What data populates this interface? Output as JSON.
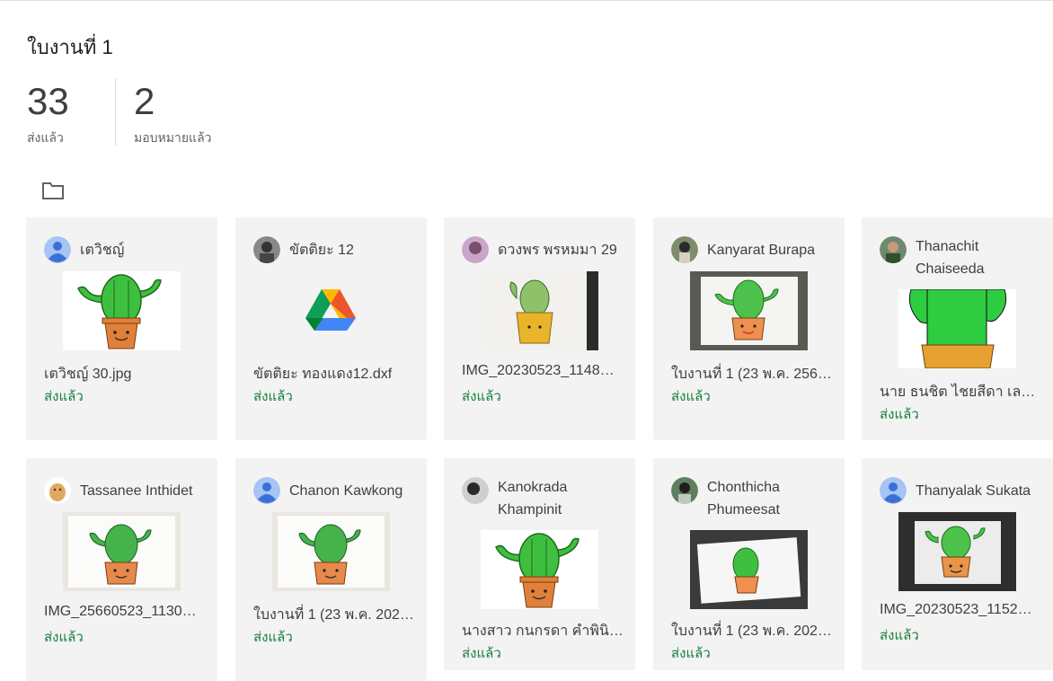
{
  "header": {
    "title": "ใบงานที่ 1",
    "submitted_count": "33",
    "submitted_label": "ส่งแล้ว",
    "assigned_count": "2",
    "assigned_label": "มอบหมายแล้ว"
  },
  "icons": {
    "folder": "folder-icon"
  },
  "colors": {
    "status_green": "#188038",
    "card_bg": "#f3f3f3",
    "cactus_green": "#3fbf3f",
    "pot_orange": "#e0803a"
  },
  "cards": [
    {
      "name": "เตวิชญ์",
      "file": "เตวิชญ์ 30.jpg",
      "status": "ส่งแล้ว"
    },
    {
      "name": "ขัตติยะ 12",
      "file": "ขัตติยะ ทองแดง12.dxf",
      "status": "ส่งแล้ว"
    },
    {
      "name": "ดวงพร พรหมมา 29",
      "file": "IMG_20230523_1148…",
      "status": "ส่งแล้ว"
    },
    {
      "name": "Kanyarat Burapa",
      "file": "ใบงานที่ 1 (23 พ.ค. 256…",
      "status": "ส่งแล้ว"
    },
    {
      "name": "Thanachit Chaiseeda",
      "file": "นาย ธนชิต ไชยสีดา เลข…",
      "status": "ส่งแล้ว"
    },
    {
      "name": "Tassanee Inthidet",
      "file": "IMG_25660523_1130…",
      "status": "ส่งแล้ว"
    },
    {
      "name": "Chanon Kawkong",
      "file": "ใบงานที่ 1 (23 พ.ค. 202…",
      "status": "ส่งแล้ว"
    },
    {
      "name": "Kanokrada Khampinit",
      "file": "นางสาว กนกรดา คำพินิ…",
      "status": "ส่งแล้ว"
    },
    {
      "name": "Chonthicha Phumeesat",
      "file": "ใบงานที่ 1 (23 พ.ค. 202…",
      "status": "ส่งแล้ว"
    },
    {
      "name": "Thanyalak Sukata",
      "file": "IMG_20230523_1152…",
      "status": "ส่งแล้ว"
    }
  ]
}
